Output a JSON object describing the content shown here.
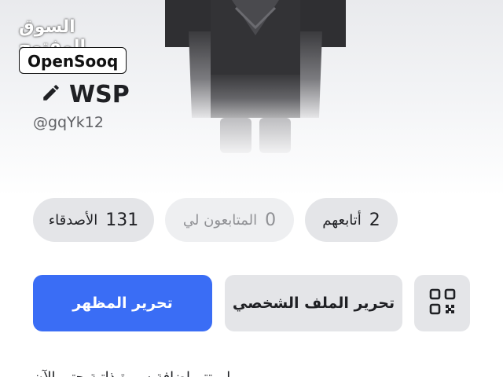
{
  "watermark": {
    "arabic": "السوق المفتوح",
    "logo": "OpenSooq"
  },
  "profile": {
    "display_name": "WSP",
    "handle": "@gqYk12",
    "edit_icon": "pencil-icon"
  },
  "stats": {
    "following": {
      "count": "2",
      "label": "أتابعهم"
    },
    "followers": {
      "count": "0",
      "label": "المتابعون لي"
    },
    "friends": {
      "count": "131",
      "label": "الأصدقاء"
    }
  },
  "actions": {
    "edit_appearance": "تحرير المظهر",
    "edit_profile": "تحرير الملف الشخصي",
    "qr_icon": "qr-code-icon"
  },
  "about": {
    "text": "لم تتم إضافة سيرة ذاتية حتى الآن"
  },
  "colors": {
    "accent": "#3a6df5",
    "pill": "#e4e5e8",
    "text": "#1f2024"
  }
}
